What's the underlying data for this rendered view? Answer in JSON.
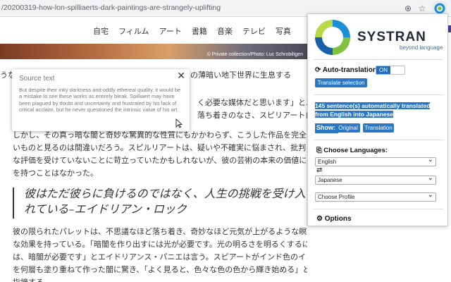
{
  "browser": {
    "url": "/20200319-how-lon-spilliaerts-dark-paintings-are-strangely-uplifting",
    "add_icon": "⊕",
    "star_icon": "☆"
  },
  "nav": {
    "items": [
      "自宅",
      "フィルム",
      "アート",
      "書籍",
      "音楽",
      "テレビ",
      "写真"
    ]
  },
  "hero": {
    "caption": "© Private collection/Photo: Luc Schrobiltgen"
  },
  "article": {
    "intro_left": "うな",
    "intro_right": "の薄暗い地下世界に生息する",
    "line1_tail": "く必要な媒体だと思います」とエ",
    "line2_tail": "落ち着きのなさ、スピリアート自",
    "para2": [
      "しかし、その真っ暗な闇と奇妙な驚異的な性質にもかかわらず、こうした作品を完全に",
      "いものと見るのは間違いだろう。スピルリアートは、疑いや不確実に悩まされ、批判",
      "な評価を受けていないことに苛立っていたかもしれないが、彼の芸術の本来の価値に疑",
      "を持つことはなかった。"
    ],
    "quote": "彼はただ彼らに負けるのではなく、人生の挑戦を受け入れている–エイドリアン・ロック",
    "para3": [
      "彼の限られたパレットは、不思議なほど落ち着き、奇妙なほど元気が上がるような瞑想的",
      "な効果を持っている。「暗闇を作り出すには光が必要です。光の明るさを明るくするに",
      "は、暗闇が必要です」とエイドリアンス・パニエは言う。スピアートがインド色のインク",
      "を何層も塗り重ねて作った闇に驚き、「よく見ると、色々な色の色から輝き始める」と",
      "指摘する。"
    ]
  },
  "popup": {
    "title": "Source text",
    "body": "But despite their inky darkness and oddly ethereal quality, it would be a mistake to see these works as entirely bleak. Spilliaert may have been plagued by doubt and uncertainty and frustrated by his lack of critical acclaim, but he never questioned the intrinsic value of his art.",
    "close": "✕"
  },
  "panel": {
    "brand": "SYSTRAN",
    "tagline": "beyond language",
    "auto_label": "Auto-translation:",
    "auto_state": "ON",
    "translate_selection": "Translate selection",
    "sentences": "145 sentence(s) automatically translated from English into Japanese",
    "show_label": "Show:",
    "show_original": "Original",
    "show_translation": "Translation",
    "choose_languages": "Choose Languages:",
    "source_lang": "English",
    "target_lang": "Japanese",
    "profile": "Choose Profile",
    "options": "Options"
  },
  "colors": {
    "accent": "#2a78c5",
    "brand_dark": "#1e2a3a"
  }
}
